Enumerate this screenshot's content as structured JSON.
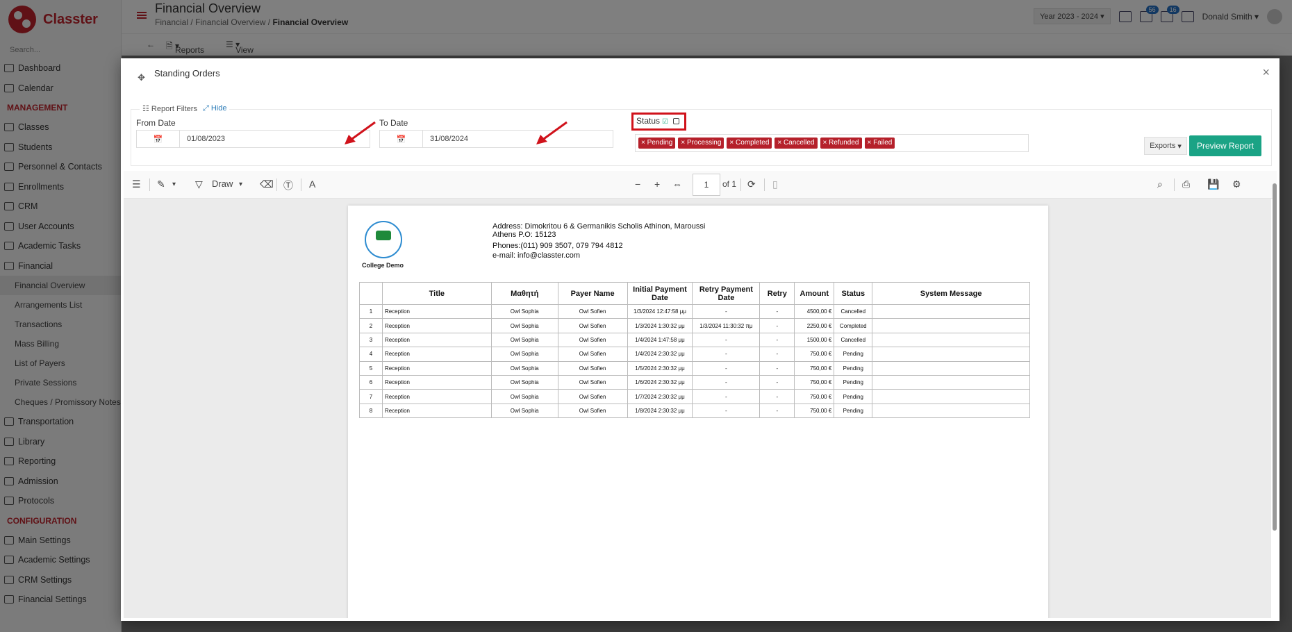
{
  "app": {
    "brand": "Classter",
    "page_title": "Financial Overview",
    "breadcrumb": [
      "Financial",
      "Financial Overview",
      "Financial Overview"
    ],
    "year_selector": "Year 2023 - 2024",
    "notification_count": "56",
    "message_count": "16",
    "user_name": "Donald Smith",
    "toolbar": {
      "reports_label": "Reports",
      "view_label": "View"
    }
  },
  "sidebar": {
    "search_placeholder": "Search...",
    "items_top": [
      "Dashboard",
      "Calendar"
    ],
    "management_title": "MANAGEMENT",
    "management_items": [
      "Classes",
      "Students",
      "Personnel & Contacts",
      "Enrollments",
      "CRM",
      "User Accounts",
      "Academic Tasks",
      "Financial"
    ],
    "financial_subitems": [
      "Financial Overview",
      "Arrangements List",
      "Transactions",
      "Mass Billing",
      "List of Payers",
      "Private Sessions",
      "Cheques / Promissory Notes"
    ],
    "more_items": [
      "Transportation",
      "Library",
      "Reporting",
      "Admission",
      "Protocols"
    ],
    "configuration_title": "CONFIGURATION",
    "configuration_items": [
      "Main Settings",
      "Academic Settings",
      "CRM Settings",
      "Financial Settings"
    ]
  },
  "modal": {
    "title": "Standing Orders",
    "filters_label": "Report Filters",
    "hide_label": "Hide",
    "from_date_label": "From Date",
    "from_date_value": "01/08/2023",
    "to_date_label": "To Date",
    "to_date_value": "31/08/2024",
    "status_label": "Status",
    "status_tags": [
      "Pending",
      "Processing",
      "Completed",
      "Cancelled",
      "Refunded",
      "Failed"
    ],
    "exports_label": "Exports",
    "preview_label": "Preview Report"
  },
  "pdf_toolbar": {
    "draw_label": "Draw",
    "page_number": "1",
    "page_total": "of 1"
  },
  "report": {
    "college_name": "College Demo",
    "address_line1": "Address: Dimokritou 6 & Germanikis Scholis Athinon, Maroussi",
    "address_line2": "Athens P.O: 15123",
    "phones": "Phones:(011) 909 3507, 079 794 4812",
    "email": "e-mail: info@classter.com",
    "columns": [
      "",
      "Title",
      "Μαθητή",
      "Payer Name",
      "Initial Payment Date",
      "Retry Payment Date",
      "Retry",
      "Amount",
      "Status",
      "System Message"
    ],
    "rows": [
      [
        "1",
        "Reception",
        "Owl Sophia",
        "Owl Sofien",
        "1/3/2024 12:47:58 μμ",
        "-",
        "-",
        "4500,00 €",
        "Cancelled",
        ""
      ],
      [
        "2",
        "Reception",
        "Owl Sophia",
        "Owl Sofien",
        "1/3/2024 1:30:32 μμ",
        "1/3/2024 11:30:32 πμ",
        "-",
        "2250,00 €",
        "Completed",
        ""
      ],
      [
        "3",
        "Reception",
        "Owl Sophia",
        "Owl Sofien",
        "1/4/2024 1:47:58 μμ",
        "-",
        "-",
        "1500,00 €",
        "Cancelled",
        ""
      ],
      [
        "4",
        "Reception",
        "Owl Sophia",
        "Owl Sofien",
        "1/4/2024 2:30:32 μμ",
        "-",
        "-",
        "750,00 €",
        "Pending",
        ""
      ],
      [
        "5",
        "Reception",
        "Owl Sophia",
        "Owl Sofien",
        "1/5/2024 2:30:32 μμ",
        "-",
        "-",
        "750,00 €",
        "Pending",
        ""
      ],
      [
        "6",
        "Reception",
        "Owl Sophia",
        "Owl Sofien",
        "1/6/2024 2:30:32 μμ",
        "-",
        "-",
        "750,00 €",
        "Pending",
        ""
      ],
      [
        "7",
        "Reception",
        "Owl Sophia",
        "Owl Sofien",
        "1/7/2024 2:30:32 μμ",
        "-",
        "-",
        "750,00 €",
        "Pending",
        ""
      ],
      [
        "8",
        "Reception",
        "Owl Sophia",
        "Owl Sofien",
        "1/8/2024 2:30:32 μμ",
        "-",
        "-",
        "750,00 €",
        "Pending",
        ""
      ]
    ]
  },
  "colors": {
    "brand": "#c0232c",
    "tag": "#b5202a",
    "preview_button": "#1aa385",
    "annotation_red": "#d0121b"
  }
}
